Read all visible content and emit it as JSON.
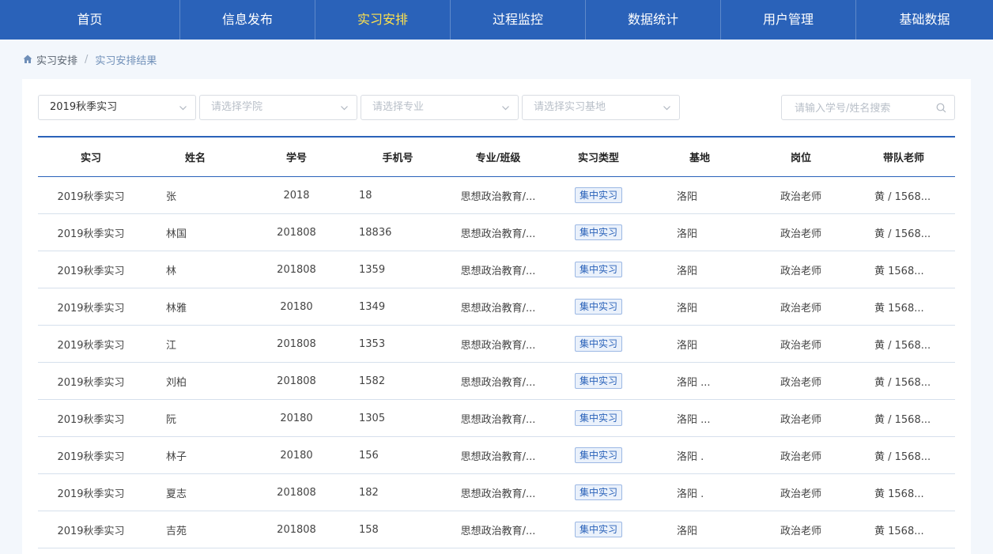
{
  "nav": [
    "首页",
    "信息发布",
    "实习安排",
    "过程监控",
    "数据统计",
    "用户管理",
    "基础数据"
  ],
  "nav_active_index": 2,
  "breadcrumb": {
    "home": "实习安排",
    "separator": "/",
    "current": "实习安排结果"
  },
  "filters": {
    "term": "2019秋季实习",
    "college_placeholder": "请选择学院",
    "major_placeholder": "请选择专业",
    "base_placeholder": "请选择实习基地",
    "search_placeholder": "请输入学号/姓名搜索"
  },
  "table": {
    "headers": [
      "实习",
      "姓名",
      "学号",
      "手机号",
      "专业/班级",
      "实习类型",
      "基地",
      "岗位",
      "带队老师"
    ],
    "rows": [
      [
        "2019秋季实习",
        "张",
        "2018",
        "18",
        "思想政治教育/...",
        "集中实习",
        "洛阳",
        "政治老师",
        "黄 / 1568..."
      ],
      [
        "2019秋季实习",
        "林国",
        "201808",
        "18836",
        "思想政治教育/...",
        "集中实习",
        "洛阳",
        "政治老师",
        "黄 / 1568..."
      ],
      [
        "2019秋季实习",
        "林",
        "201808",
        "1359",
        "思想政治教育/...",
        "集中实习",
        "洛阳",
        "政治老师",
        "黄 1568..."
      ],
      [
        "2019秋季实习",
        "林雅",
        "20180",
        "1349",
        "思想政治教育/...",
        "集中实习",
        "洛阳",
        "政治老师",
        "黄 1568..."
      ],
      [
        "2019秋季实习",
        "江",
        "201808",
        "1353",
        "思想政治教育/...",
        "集中实习",
        "洛阳",
        "政治老师",
        "黄 / 1568..."
      ],
      [
        "2019秋季实习",
        "刘柏",
        "201808",
        "1582",
        "思想政治教育/...",
        "集中实习",
        "洛阳 ...",
        "政治老师",
        "黄 / 1568..."
      ],
      [
        "2019秋季实习",
        "阮",
        "20180",
        "1305",
        "思想政治教育/...",
        "集中实习",
        "洛阳 ...",
        "政治老师",
        "黄 / 1568..."
      ],
      [
        "2019秋季实习",
        "林子",
        "20180",
        "156",
        "思想政治教育/...",
        "集中实习",
        "洛阳 .",
        "政治老师",
        "黄 / 1568..."
      ],
      [
        "2019秋季实习",
        "夏志",
        "201808",
        "182",
        "思想政治教育/...",
        "集中实习",
        "洛阳 .",
        "政治老师",
        "黄 1568..."
      ],
      [
        "2019秋季实习",
        "吉苑",
        "201808",
        "158",
        "思想政治教育/...",
        "集中实习",
        "洛阳",
        "政治老师",
        "黄 1568..."
      ]
    ]
  },
  "colors": {
    "primary": "#2a62b9",
    "active_nav": "#ffe24d",
    "tag_bg": "#eaf1fb"
  },
  "icons": {
    "home": "home-icon",
    "chevron": "chevron-down-icon",
    "search": "search-icon"
  }
}
